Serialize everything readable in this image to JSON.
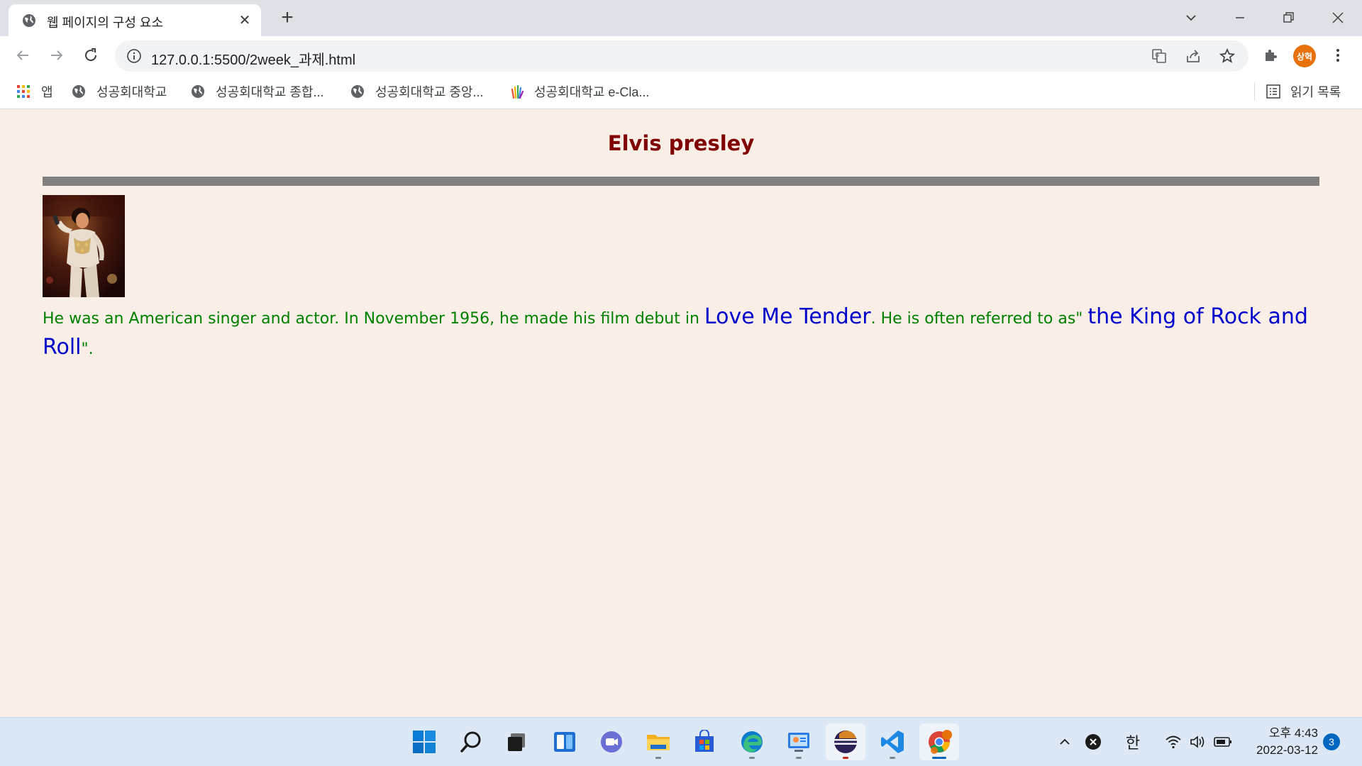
{
  "browser": {
    "tab_title": "웹 페이지의 구성 요소",
    "tab_close": "✕",
    "new_tab": "+",
    "url": "127.0.0.1:5500/2week_과제.html",
    "profile_initials": "상혁"
  },
  "bookmarks": {
    "items": [
      {
        "label": "앱",
        "icon": "apps-grid-icon"
      },
      {
        "label": "성공회대학교",
        "icon": "globe-icon"
      },
      {
        "label": "성공회대학교 종합...",
        "icon": "globe-icon"
      },
      {
        "label": "성공회대학교 중앙...",
        "icon": "globe-icon"
      },
      {
        "label": "성공회대학교 e-Cla...",
        "icon": "hands-logo-icon"
      }
    ],
    "reading_list": "읽기 목록"
  },
  "page": {
    "heading": "Elvis presley",
    "para_part1": "He was an American singer and actor. In November 1956, he made his film debut in ",
    "para_big1": "Love Me Tender",
    "para_part2": ". He is often referred to as\" ",
    "para_big2": "the King of Rock and Roll",
    "para_part3": "\".",
    "heading_color": "#800000",
    "text_color": "#008000",
    "highlight_color": "#0000cd",
    "background": "#faefe6"
  },
  "taskbar": {
    "ime_label": "한",
    "clock_time": "오후 4:43",
    "clock_date": "2022-03-12",
    "notification_count": "3"
  }
}
